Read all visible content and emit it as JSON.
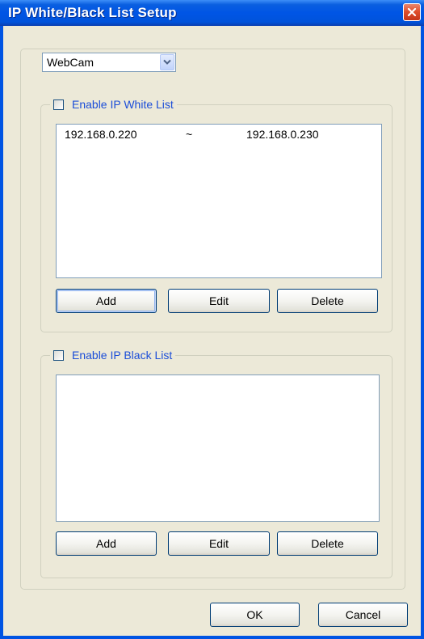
{
  "window": {
    "title": "IP White/Black List Setup"
  },
  "device_select": {
    "value": "WebCam"
  },
  "white_list": {
    "enable_label": "Enable IP White List",
    "checked": false,
    "entries": [
      {
        "start": "192.168.0.220",
        "separator": "~",
        "end": "192.168.0.230"
      }
    ],
    "add_label": "Add",
    "edit_label": "Edit",
    "delete_label": "Delete"
  },
  "black_list": {
    "enable_label": "Enable IP Black List",
    "checked": false,
    "entries": [],
    "add_label": "Add",
    "edit_label": "Edit",
    "delete_label": "Delete"
  },
  "footer": {
    "ok_label": "OK",
    "cancel_label": "Cancel"
  },
  "colors": {
    "titlebar": "#0054e3",
    "dialog_bg": "#ece9d8",
    "legend_text": "#1c4ed8",
    "close_button": "#e0502d"
  }
}
